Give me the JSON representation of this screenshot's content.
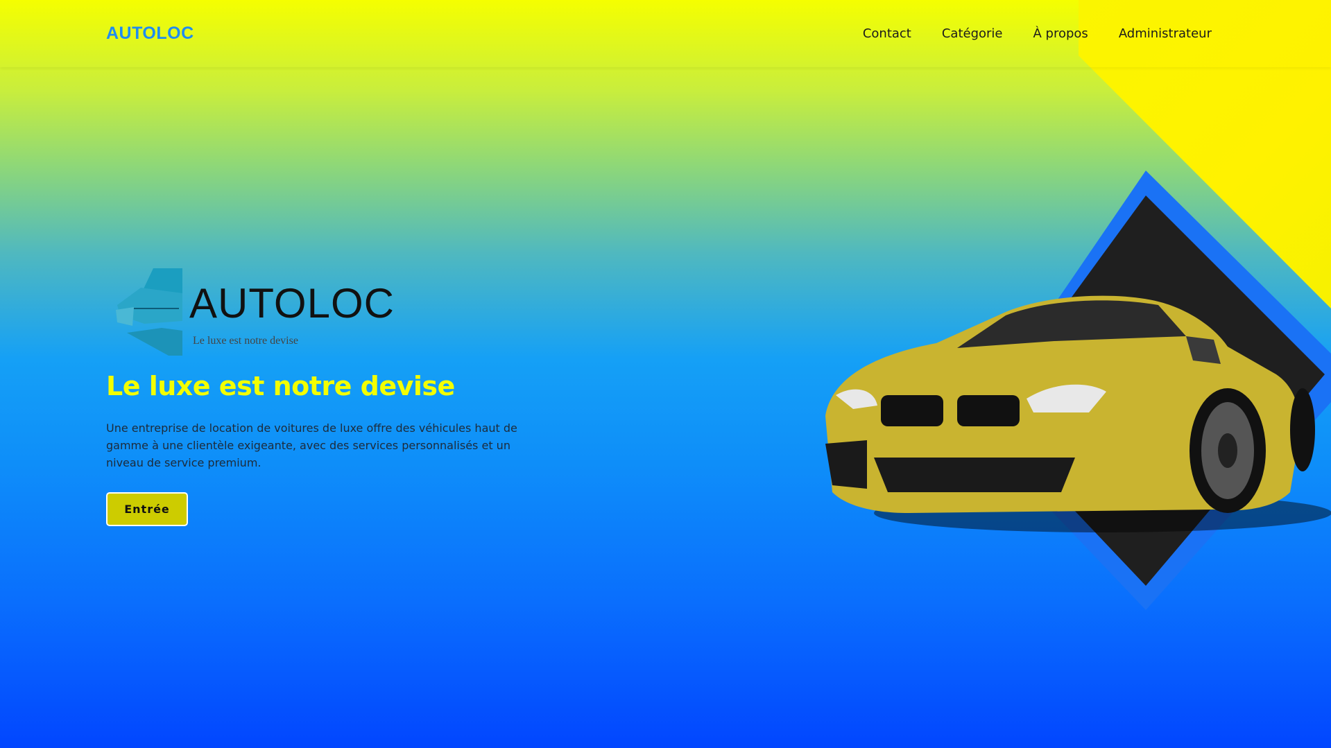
{
  "navbar": {
    "brand": "AUTOLOC",
    "links": [
      "Contact",
      "Catégorie",
      "À propos",
      "Administrateur"
    ]
  },
  "hero": {
    "logo_text": "AUTOLOC",
    "logo_tagline": "Le luxe est notre devise",
    "headline": "Le luxe est notre devise",
    "description": "Une entreprise de location de voitures de luxe offre des véhicules haut de gamme à une clientèle exigeante, avec des services personnalisés et un niveau de service premium.",
    "cta_label": "Entrée"
  },
  "colors": {
    "brand_blue": "#1f8cf0",
    "headline_yellow": "#f3ff00",
    "button_yellow": "#cdcc00",
    "diamond_blue": "#1a72f5",
    "diamond_dark": "#1f1f1f",
    "car_gold": "#c9b430"
  },
  "icons": {
    "logo_mark": "car-logo-icon",
    "car": "car-illustration"
  }
}
